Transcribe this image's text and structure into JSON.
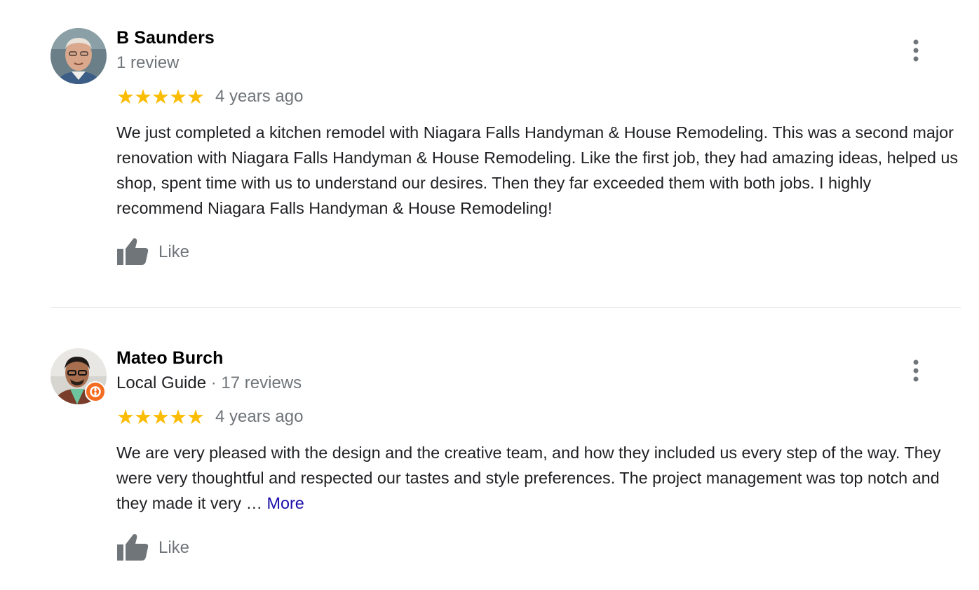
{
  "colors": {
    "star": "#fbbc04",
    "secondary_text": "#70757a",
    "link": "#1a0dab",
    "local_guide_badge": "#f36c21"
  },
  "icons": {
    "avatar": "avatar",
    "rating": "star-icon",
    "like": "thumbs-up-icon",
    "menu": "more-vertical-icon",
    "badge": "local-guide-badge-icon"
  },
  "reviews": [
    {
      "name": "B Saunders",
      "review_count": "1 review",
      "rating": 5,
      "stars": "★★★★★",
      "time": "4 years ago",
      "text": "We just completed a kitchen remodel with Niagara Falls Handyman & House Remodeling. This was a second major renovation with Niagara Falls Handyman & House Remodeling. Like the first job, they had amazing ideas, helped us shop, spent time with us to understand our desires. Then they far exceeded them with both jobs. I highly recommend Niagara Falls Handyman & House Remodeling!",
      "like_label": "Like"
    },
    {
      "name": "Mateo Burch",
      "badge_label": "Local Guide",
      "separator": " · ",
      "review_count": "17 reviews",
      "rating": 5,
      "stars": "★★★★★",
      "time": "4 years ago",
      "text": "We are very pleased with the design and the creative team, and how they included us every step of the way. They were very thoughtful and respected our tastes and style preferences. The project management was top notch and they made it very … ",
      "more_label": "More",
      "like_label": "Like"
    }
  ]
}
